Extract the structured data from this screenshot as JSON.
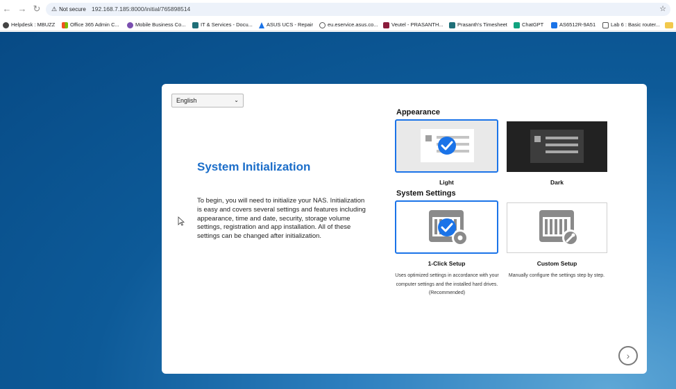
{
  "browser": {
    "nav": {
      "back": "←",
      "forward": "→",
      "reload": "↻"
    },
    "security_label": "Not secure",
    "url": "192.168.7.185:8000/initial/765898514",
    "bookmarks": [
      {
        "label": "Helpdesk : MBUZZ",
        "icon_color": "#444444"
      },
      {
        "label": "Office 365 Admin C...",
        "icon_color": "#e8491d"
      },
      {
        "label": "Mobile Business Co...",
        "icon_color": "#7a4fb0"
      },
      {
        "label": "IT & Services - Docu...",
        "icon_color": "#1f6f78"
      },
      {
        "label": "ASUS UCS - Repair",
        "icon_color": "#1a73e8"
      },
      {
        "label": "eu.eservice.asus.co...",
        "icon_color": "#555555"
      },
      {
        "label": "Veutel - PRASANTH...",
        "icon_color": "#8a1c3c"
      },
      {
        "label": "Prasanth's Timesheet",
        "icon_color": "#1f6f78"
      },
      {
        "label": "ChatGPT",
        "icon_color": "#10a37f"
      },
      {
        "label": "AS6512R-9A51",
        "icon_color": "#1a73e8"
      },
      {
        "label": "Lab 6 : Basic router...",
        "icon_color": "#555555"
      }
    ]
  },
  "language": {
    "selected": "English"
  },
  "intro": {
    "title": "System Initialization",
    "body": "To begin, you will need to initialize your NAS. Initialization is easy and covers several settings and features including appearance, time and date, security, storage volume settings, registration and app installation. All of these settings can be changed after initialization."
  },
  "appearance": {
    "label": "Appearance",
    "options": [
      {
        "name": "Light",
        "selected": true
      },
      {
        "name": "Dark",
        "selected": false
      }
    ]
  },
  "system_settings": {
    "label": "System Settings",
    "options": [
      {
        "name": "1-Click Setup",
        "description": "Uses optimized settings in accordance with your computer settings and the installed hard drives. (Recommended)",
        "selected": true
      },
      {
        "name": "Custom Setup",
        "description": "Manually configure the settings step by step.",
        "selected": false
      }
    ]
  },
  "next_button": "›",
  "colors": {
    "accent": "#1a73e8",
    "title_blue": "#1c6ec9",
    "dark_tile": "#222222"
  }
}
